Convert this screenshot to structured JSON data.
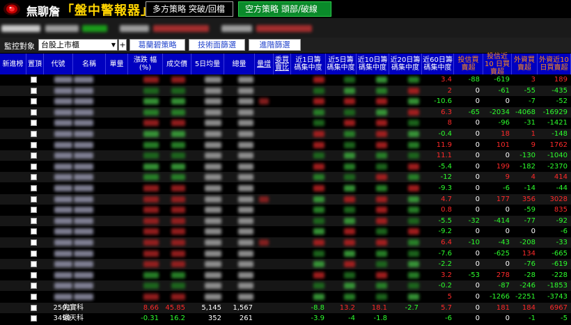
{
  "app": {
    "name": "無聊詹",
    "subtitle": "「盤中警報器」"
  },
  "strategies": {
    "long": "多方策略  突破/回檔",
    "short": "空方策略  頭部/破線"
  },
  "controls": {
    "monitor_label": "監控對象",
    "market_value": "台股上市櫃",
    "plus_label": "+",
    "buttons": [
      "葛蘭碧策略",
      "技術面篩選",
      "進階篩選"
    ]
  },
  "columns": [
    {
      "label": "新進榜"
    },
    {
      "label": "置頂"
    },
    {
      "label": "代號"
    },
    {
      "label": "名稱"
    },
    {
      "label": "單量"
    },
    {
      "label": "漲跌 幅 (%)"
    },
    {
      "label": "成交價"
    },
    {
      "label": "5日均量"
    },
    {
      "label": "總量"
    },
    {
      "label": "量增"
    },
    {
      "label": "委買 賣比"
    },
    {
      "label": "近1日籌 碼集中度"
    },
    {
      "label": "近5日籌 碼集中度"
    },
    {
      "label": "近10日籌 碼集中度"
    },
    {
      "label": "近20日籌 碼集中度"
    },
    {
      "label": "近60日籌 碼集中度"
    },
    {
      "label": "投信買 賣超"
    },
    {
      "label": "投信近10 日買賣超"
    },
    {
      "label": "外資買 賣超"
    },
    {
      "label": "外資近10 日買賣超"
    }
  ],
  "colors": {
    "header_bg": "#0000c0",
    "green": "#2dff2d",
    "red": "#ff2a2a",
    "orange_header": "#ff8c1a",
    "short_btn": "#0a8a2a"
  },
  "rows": [
    [
      "3.4",
      "-88",
      "-619",
      "3",
      "189"
    ],
    [
      "2",
      "0",
      "-61",
      "-55",
      "-435"
    ],
    [
      "-10.6",
      "0",
      "0",
      "-7",
      "-52"
    ],
    [
      "6.3",
      "-65",
      "-2034",
      "-4068",
      "-16929"
    ],
    [
      "8",
      "0",
      "-96",
      "-31",
      "-1421"
    ],
    [
      "-0.4",
      "0",
      "18",
      "1",
      "-148"
    ],
    [
      "11.9",
      "0",
      "101",
      "9",
      "1762"
    ],
    [
      "11.1",
      "0",
      "0",
      "-130",
      "-1040"
    ],
    [
      "-5.4",
      "0",
      "199",
      "-182",
      "-2370"
    ],
    [
      "-12",
      "0",
      "9",
      "4",
      "414"
    ],
    [
      "-9.3",
      "0",
      "-6",
      "-14",
      "-44"
    ],
    [
      "4.7",
      "0",
      "177",
      "356",
      "3028"
    ],
    [
      "0.8",
      "0",
      "0",
      "-59",
      "835"
    ],
    [
      "-5.5",
      "-32",
      "-414",
      "-77",
      "-92"
    ],
    [
      "-9.2",
      "0",
      "0",
      "0",
      "-6"
    ],
    [
      "6.4",
      "-10",
      "-43",
      "-208",
      "-33"
    ],
    [
      "-7.6",
      "0",
      "-625",
      "134",
      "-665"
    ],
    [
      "-2.2",
      "0",
      "0",
      "-76",
      "-619"
    ],
    [
      "3.2",
      "-53",
      "278",
      "-28",
      "-228"
    ],
    [
      "-0.2",
      "0",
      "-87",
      "-246",
      "-1853"
    ],
    [
      "5",
      "0",
      "-1266",
      "-2251",
      "-3743"
    ],
    [
      "5.7",
      "0",
      "181",
      "184",
      "6967"
    ],
    [
      "-6",
      "0",
      "0",
      "-1",
      "-5"
    ]
  ],
  "visible_rows": [
    {
      "code": "2501",
      "name": "先實科",
      "change": "8.66",
      "price": "45.85",
      "avg5": "5,145",
      "total": "1,567",
      "c1": "-8.8",
      "c5": "13.2",
      "c10": "18.1",
      "c20": "-2.7"
    },
    {
      "code": "3499",
      "name": "環天科",
      "change": "-0.31",
      "price": "16.2",
      "avg5": "352",
      "total": "261",
      "c1": "-3.9",
      "c5": "-4",
      "c10": "-1.8",
      "c20": ""
    }
  ]
}
